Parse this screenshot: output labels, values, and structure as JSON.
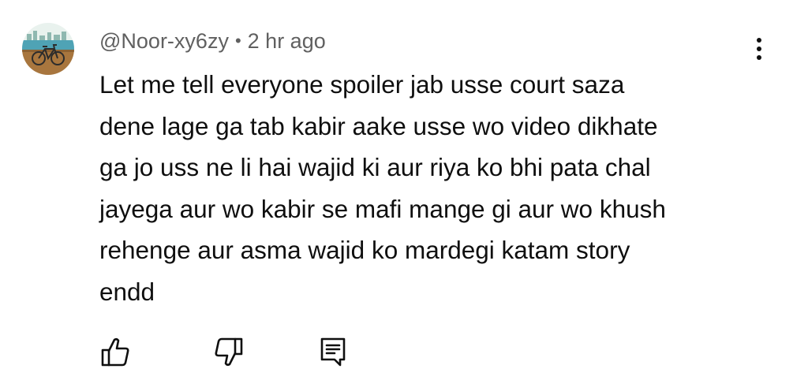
{
  "comment": {
    "author": "@Noor-xy6zy",
    "separator": "•",
    "timestamp": "2 hr ago",
    "text_lines": [
      "Let me tell everyone spoiler jab usse court saza",
      "dene lage ga tab kabir aake usse wo video dikhate",
      "ga jo uss ne li hai wajid ki aur riya ko bhi pata chal",
      "jayega aur wo kabir se mafi mange gi aur wo khush",
      "rehenge aur asma wajid ko mardegi katam story",
      "endd"
    ],
    "avatar": {
      "icon": "bicycle-icon",
      "colors": {
        "sky": "#e9f2ee",
        "water": "#4fa3b5",
        "ground": "#a8763e",
        "bike": "#2c2c2c"
      }
    },
    "actions": {
      "like_icon": "thumbs-up-icon",
      "dislike_icon": "thumbs-down-icon",
      "reply_icon": "comment-icon",
      "more_icon": "more-vert-icon"
    }
  },
  "colors": {
    "text_primary": "#0f0f0f",
    "text_secondary": "#606060",
    "background": "#ffffff"
  }
}
